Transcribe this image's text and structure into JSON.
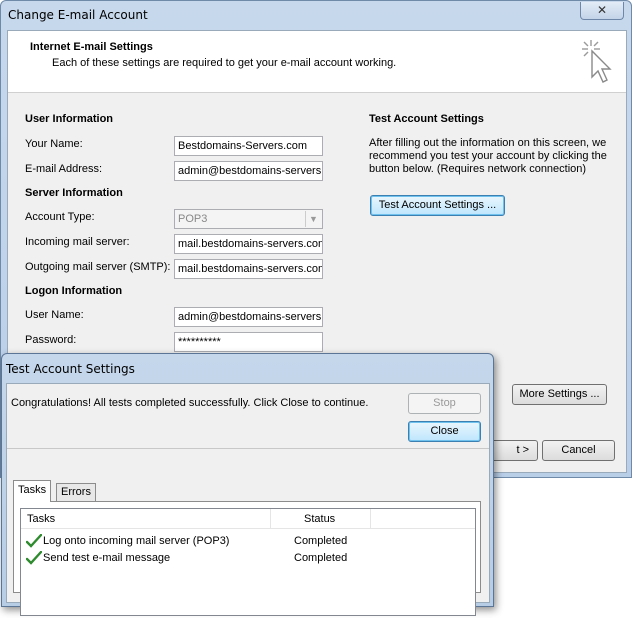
{
  "window": {
    "title": "Change E-mail Account",
    "close_glyph": "✕"
  },
  "header": {
    "title": "Internet E-mail Settings",
    "subtitle": "Each of these settings are required to get your e-mail account working."
  },
  "user_info": {
    "heading": "User Information",
    "name_label": "Your Name:",
    "name_value": "Bestdomains-Servers.com",
    "email_label": "E-mail Address:",
    "email_value": "admin@bestdomains-servers.com"
  },
  "server_info": {
    "heading": "Server Information",
    "account_type_label": "Account Type:",
    "account_type_value": "POP3",
    "incoming_label": "Incoming mail server:",
    "incoming_value": "mail.bestdomains-servers.com",
    "outgoing_label": "Outgoing mail server (SMTP):",
    "outgoing_value": "mail.bestdomains-servers.com"
  },
  "logon_info": {
    "heading": "Logon Information",
    "user_label": "User Name:",
    "user_value": "admin@bestdomains-servers.com",
    "password_label": "Password:",
    "password_value": "**********"
  },
  "test_settings": {
    "heading": "Test Account Settings",
    "description_line1": "After filling out the information on this screen, we",
    "description_line2": "recommend you test your account by clicking the",
    "description_line3": "button below. (Requires network connection)",
    "button_label": "Test Account Settings ..."
  },
  "buttons": {
    "more_settings": "More Settings ...",
    "next": "t >",
    "cancel": "Cancel"
  },
  "test_dialog": {
    "title": "Test Account Settings",
    "message": "Congratulations! All tests completed successfully. Click Close to continue.",
    "stop_label": "Stop",
    "close_label": "Close",
    "tabs": [
      {
        "label": "Tasks"
      },
      {
        "label": "Errors"
      }
    ],
    "columns": {
      "tasks": "Tasks",
      "status": "Status"
    },
    "rows": [
      {
        "task": "Log onto incoming mail server (POP3)",
        "status": "Completed",
        "icon": "checkmark-icon"
      },
      {
        "task": "Send test e-mail message",
        "status": "Completed",
        "icon": "checkmark-icon"
      }
    ]
  },
  "colors": {
    "check_green": "#2e8b2e",
    "focus_blue": "#3c7fb1"
  }
}
